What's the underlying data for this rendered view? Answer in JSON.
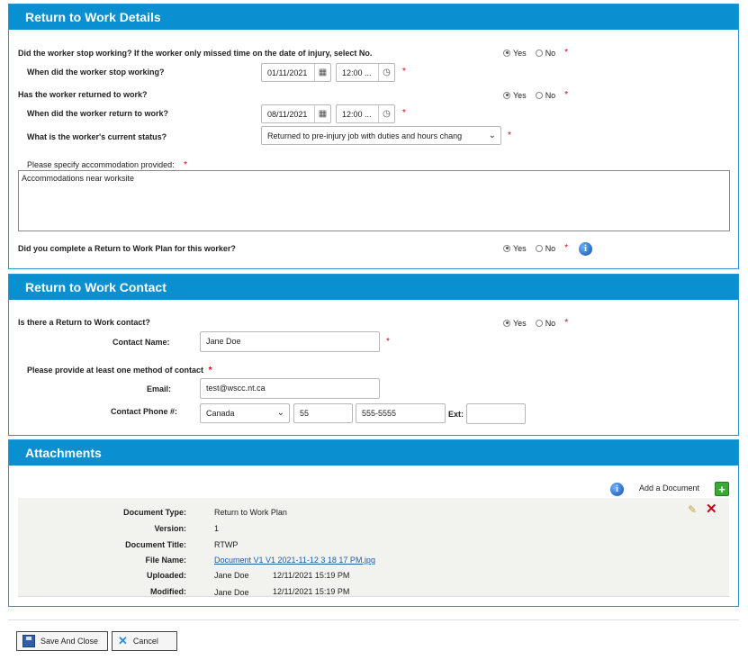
{
  "sections": {
    "rtw_details": {
      "title": "Return to Work Details",
      "q_stopped": "Did the worker stop working? If the worker only missed time on the date of injury, select No.",
      "q_stop_date": "When did the worker stop working?",
      "stop_date": "01/11/2021",
      "stop_time": "12:00 ...",
      "q_returned": "Has the worker returned to work?",
      "q_return_date": "When did the worker return to work?",
      "return_date": "08/11/2021",
      "return_time": "12:00 ...",
      "q_status": "What is the worker's current status?",
      "status_value": "Returned to pre-injury job with duties and hours chang",
      "q_accommodation": "Please specify accommodation provided:",
      "accommodation_value": "Accommodations near worksite",
      "q_rtw_plan": "Did you complete a Return to Work Plan for this worker?"
    },
    "rtw_contact": {
      "title": "Return to Work Contact",
      "q_contact": "Is there a Return to Work contact?",
      "contact_name_label": "Contact Name:",
      "contact_name": "Jane Doe",
      "method_prompt": "Please provide at least one method of contact",
      "email_label": "Email:",
      "email": "test@wscc.nt.ca",
      "phone_label": "Contact Phone #:",
      "country": "Canada",
      "area_code": "55",
      "phone": "555-5555",
      "ext_label": "Ext:",
      "ext": ""
    },
    "attachments": {
      "title": "Attachments",
      "add_document": "Add a Document",
      "doc_type_label": "Document Type:",
      "doc_type": "Return to Work Plan",
      "version_label": "Version:",
      "version": "1",
      "doc_title_label": "Document Title:",
      "doc_title": "RTWP",
      "file_name_label": "File Name:",
      "file_name": "Document V1 V1 2021-11-12 3 18 17 PM.jpg",
      "uploaded_label": "Uploaded:",
      "uploaded_by": "Jane Doe",
      "uploaded_at": "12/11/2021 15:19 PM",
      "modified_label": "Modified:",
      "modified_by": "Jane Doe",
      "modified_at": "12/11/2021 15:19 PM"
    }
  },
  "radio": {
    "yes": "Yes",
    "no": "No"
  },
  "required_mark": "*",
  "buttons": {
    "save_close": "Save And Close",
    "cancel": "Cancel"
  },
  "icons": [
    "calendar-icon",
    "clock-icon",
    "chevron-down-icon",
    "info-icon",
    "add-icon",
    "edit-icon",
    "delete-icon",
    "save-icon",
    "cancel-icon"
  ],
  "colors": {
    "header_bg": "#0a8fd1",
    "required": "#d0021b",
    "link": "#1a5ea8"
  }
}
